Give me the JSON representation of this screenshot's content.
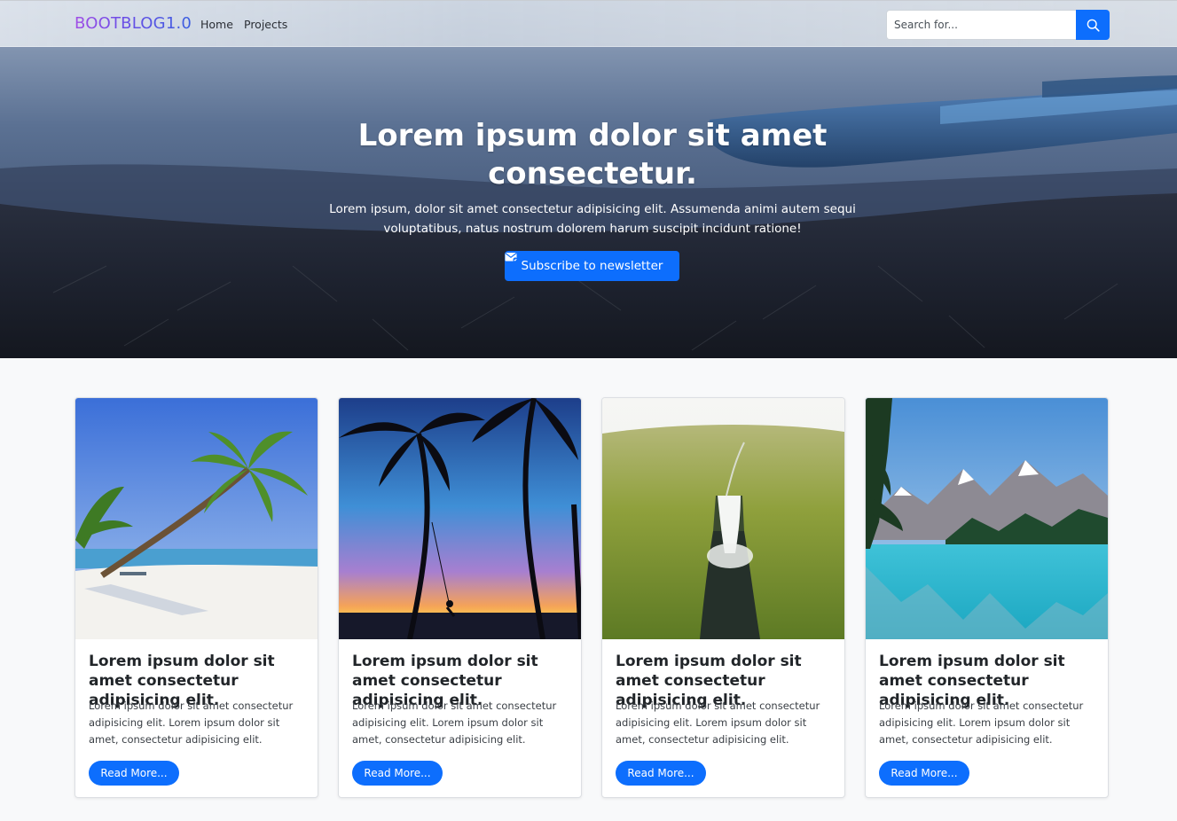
{
  "navbar": {
    "brand": "BOOTBLOG1.0",
    "links": [
      {
        "label": "Home"
      },
      {
        "label": "Projects"
      }
    ],
    "search": {
      "placeholder": "Search for...",
      "value": ""
    }
  },
  "hero": {
    "title": "Lorem ipsum dolor sit amet consectetur.",
    "subtitle": "Lorem ipsum, dolor sit amet consectetur adipisicing elit. Assumenda animi autem sequi voluptatibus, natus nostrum dolorem harum suscipit incidunt ratione!",
    "cta_label": "Subscribe to newsletter"
  },
  "cards": [
    {
      "image": "beach-palm-photo",
      "title": "Lorem ipsum dolor sit amet consectetur adipisicing elit.",
      "text": "Lorem ipsum dolor sit amet consectetur adipisicing elit. Lorem ipsum dolor sit amet, consectetur adipisicing elit.",
      "button": "Read More..."
    },
    {
      "image": "sunset-swing-photo",
      "title": "Lorem ipsum dolor sit amet consectetur adipisicing elit.",
      "text": "Lorem ipsum dolor sit amet consectetur adipisicing elit. Lorem ipsum dolor sit amet, consectetur adipisicing elit.",
      "button": "Read More..."
    },
    {
      "image": "waterfall-valley-photo",
      "title": "Lorem ipsum dolor sit amet consectetur adipisicing elit.",
      "text": "Lorem ipsum dolor sit amet consectetur adipisicing elit. Lorem ipsum dolor sit amet, consectetur adipisicing elit.",
      "button": "Read More..."
    },
    {
      "image": "mountain-lake-photo",
      "title": "Lorem ipsum dolor sit amet consectetur adipisicing elit.",
      "text": "Lorem ipsum dolor sit amet consectetur adipisicing elit. Lorem ipsum dolor sit amet, consectetur adipisicing elit.",
      "button": "Read More..."
    }
  ],
  "colors": {
    "primary": "#0d6efd",
    "page_background": "#f8f9fa"
  }
}
